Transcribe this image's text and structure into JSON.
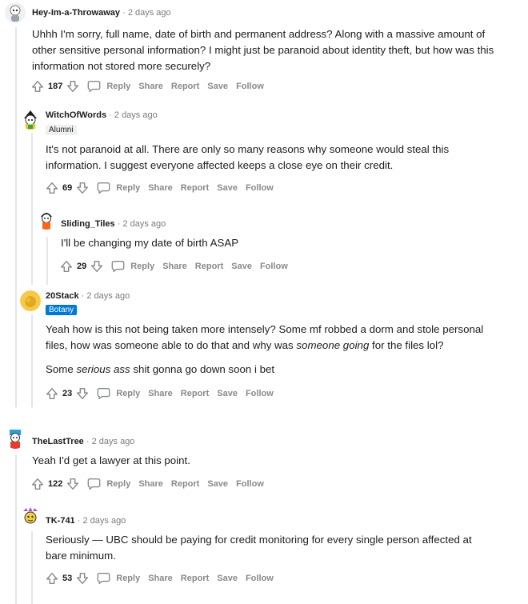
{
  "comments": [
    {
      "username": "Hey-Im-a-Throwaway",
      "sep": "·",
      "time": "2 days ago",
      "paragraphs": [
        [
          "Uhhh I'm sorry, full name, date of birth and permanent address? Along with a massive amount of other sensitive personal information? I might just be paranoid about identity theft, but how was this information not stored more securely?"
        ]
      ],
      "score": "187",
      "actions": {
        "reply": "Reply",
        "share": "Share",
        "report": "Report",
        "save": "Save",
        "follow": "Follow"
      }
    },
    {
      "username": "WitchOfWords",
      "sep": "·",
      "time": "2 days ago",
      "flair": "Alumni",
      "paragraphs": [
        [
          "It's not paranoid at all. There are only so many reasons why someone would steal this information. I suggest everyone affected keeps a close eye on their credit."
        ]
      ],
      "score": "69",
      "actions": {
        "reply": "Reply",
        "share": "Share",
        "report": "Report",
        "save": "Save",
        "follow": "Follow"
      }
    },
    {
      "username": "Sliding_Tiles",
      "sep": "·",
      "time": "2 days ago",
      "paragraphs": [
        [
          "I'll be changing my date of birth ASAP"
        ]
      ],
      "score": "29",
      "actions": {
        "reply": "Reply",
        "share": "Share",
        "report": "Report",
        "save": "Save",
        "follow": "Follow"
      }
    },
    {
      "username": "20Stack",
      "sep": "·",
      "time": "2 days ago",
      "flair": "Botany",
      "paragraphs": [
        [
          "Yeah how is this not being taken more intensely? Some mf robbed a dorm and stole personal files, how was someone able to do that and why was ",
          "someone going",
          " for the files lol?"
        ],
        [
          "Some ",
          "serious ass",
          " shit gonna go down soon i bet"
        ]
      ],
      "score": "23",
      "actions": {
        "reply": "Reply",
        "share": "Share",
        "report": "Report",
        "save": "Save",
        "follow": "Follow"
      }
    },
    {
      "username": "TheLastTree",
      "sep": "·",
      "time": "2 days ago",
      "paragraphs": [
        [
          "Yeah I'd get a lawyer at this point."
        ]
      ],
      "score": "122",
      "actions": {
        "reply": "Reply",
        "share": "Share",
        "report": "Report",
        "save": "Save",
        "follow": "Follow"
      }
    },
    {
      "username": "TK-741",
      "sep": "·",
      "time": "2 days ago",
      "paragraphs": [
        [
          "Seriously — UBC should be paying for credit monitoring for every single person affected at bare minimum."
        ]
      ],
      "score": "53",
      "actions": {
        "reply": "Reply",
        "share": "Share",
        "report": "Report",
        "save": "Save",
        "follow": "Follow"
      }
    }
  ],
  "colors": {
    "meta_grey": "#787c7e",
    "action_grey": "#878a8c",
    "thread_line": "#e5e6e8",
    "flair_blue": "#0079d3",
    "flair_grey": "#edeff1"
  },
  "icons": [
    "upvote-icon",
    "downvote-icon",
    "comment-bubble-icon",
    "avatar"
  ]
}
